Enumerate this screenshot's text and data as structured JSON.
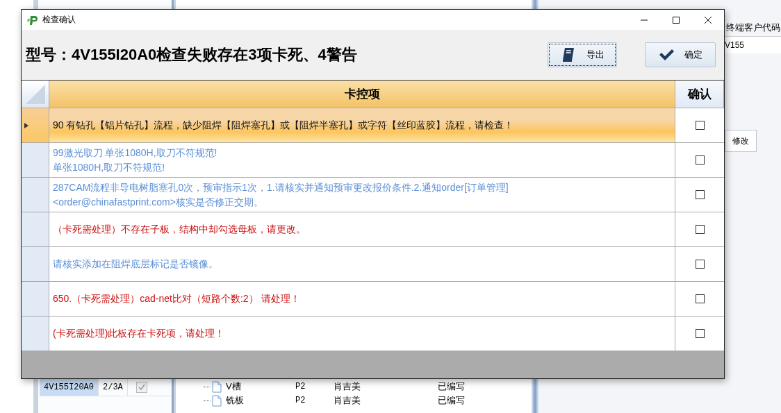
{
  "background": {
    "left_table": {
      "rows": [
        {
          "cells": [
            "4V155I20A0",
            "2/3A"
          ],
          "checked": true,
          "disabled": true,
          "selected": true
        }
      ]
    },
    "tree": {
      "rows": [
        {
          "name": "V槽",
          "column_2": "P2",
          "column_3": "肖吉美",
          "column_4": "已编写"
        },
        {
          "name": "铣板",
          "column_2": "P2",
          "column_3": "肖吉美",
          "column_4": "已编写"
        }
      ]
    },
    "right_panel": {
      "column_header": "终端客户代码",
      "field_value": "V155",
      "tab": "修改"
    }
  },
  "dialog": {
    "title": "检查确认",
    "heading": "型号：4V155I20A0检查失败存在3项卡死、4警告",
    "buttons": [
      {
        "label": "导出",
        "kind": "export",
        "focused": true
      },
      {
        "label": "确定",
        "kind": "ok",
        "focused": false
      }
    ],
    "table": {
      "columns": [
        "卡控项",
        "确认"
      ],
      "rows": [
        {
          "text": "90 有钻孔【铝片钻孔】流程，缺少阻焊【阻焊塞孔】或【阻焊半塞孔】或字符【丝印蓝胶】流程，请检查！",
          "kind": "warning",
          "selected": true,
          "checked": false
        },
        {
          "text": "99激光取刀 单张1080H,取刀不符规范!\n单张1080H,取刀不符规范!",
          "kind": "warning",
          "selected": false,
          "checked": false
        },
        {
          "text": "287CAM流程非导电树脂塞孔0次，预审指示1次，1.请核实并通知预审更改报价条件.2.通知order[订单管理]\n<order@chinafastprint.com>核实是否修正交期。",
          "kind": "warning",
          "selected": false,
          "checked": false
        },
        {
          "text": "（卡死需处理）不存在子板，结构中却勾选母板，请更改。",
          "kind": "block",
          "selected": false,
          "checked": false
        },
        {
          "text": "请核实添加在阻焊底层标记是否镜像。",
          "kind": "warning",
          "selected": false,
          "checked": false
        },
        {
          "text": "650.（卡死需处理）cad-net比对（短路个数:2） 请处理！",
          "kind": "block",
          "selected": false,
          "checked": false
        },
        {
          "text": "(卡死需处理)此板存在卡死项，请处理！",
          "kind": "block",
          "selected": false,
          "checked": false
        }
      ]
    }
  }
}
